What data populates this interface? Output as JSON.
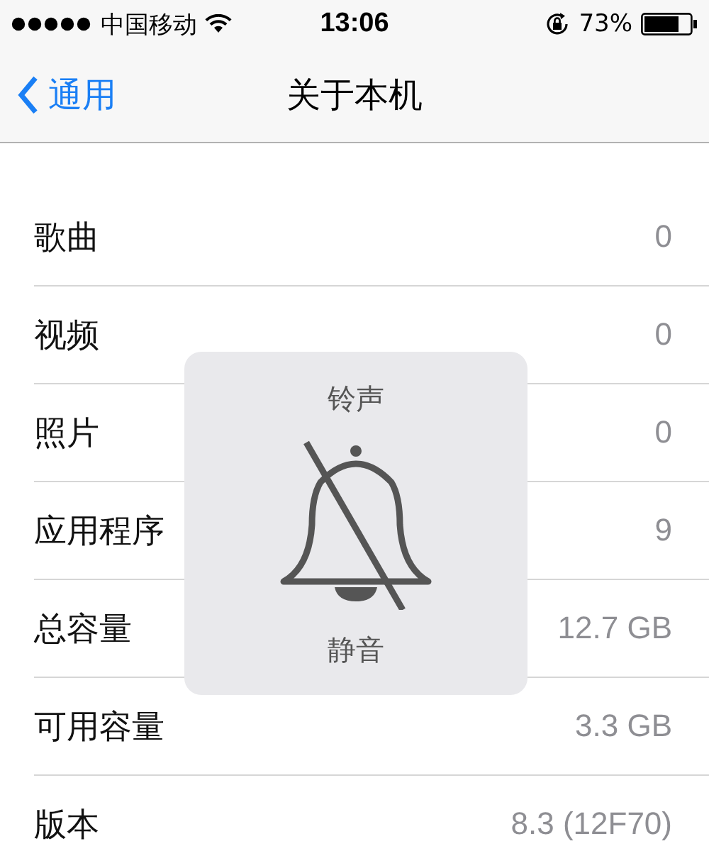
{
  "status_bar": {
    "carrier": "中国移动",
    "time": "13:06",
    "battery": "73%"
  },
  "nav": {
    "back": "通用",
    "title": "关于本机"
  },
  "rows": [
    {
      "label": "歌曲",
      "value": "0"
    },
    {
      "label": "视频",
      "value": "0"
    },
    {
      "label": "照片",
      "value": "0"
    },
    {
      "label": "应用程序",
      "value": "9"
    },
    {
      "label": "总容量",
      "value": "12.7 GB"
    },
    {
      "label": "可用容量",
      "value": "3.3 GB"
    },
    {
      "label": "版本",
      "value": "8.3 (12F70)"
    }
  ],
  "hud": {
    "title": "铃声",
    "status": "静音"
  }
}
